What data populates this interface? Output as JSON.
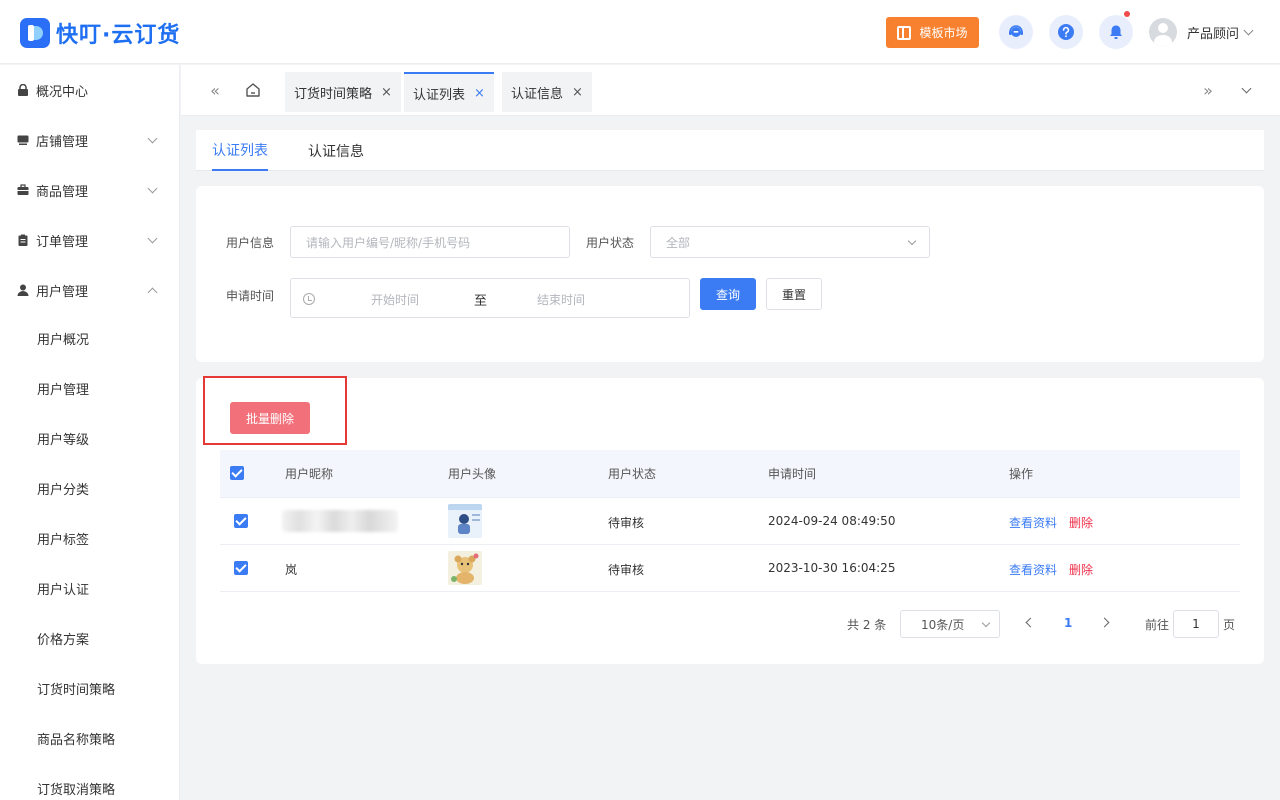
{
  "app": {
    "logo_text": "快叮·云订货"
  },
  "header": {
    "template_market_label": "模板市场",
    "user_name": "产品顾问",
    "icons": [
      "service-icon",
      "help-icon",
      "bell-icon"
    ]
  },
  "sidebar": {
    "groups": [
      {
        "label": "概况中心"
      },
      {
        "label": "店铺管理"
      },
      {
        "label": "商品管理"
      },
      {
        "label": "订单管理"
      },
      {
        "label": "用户管理"
      }
    ],
    "sub_items": [
      "用户概况",
      "用户管理",
      "用户等级",
      "用户分类",
      "用户标签",
      "用户认证",
      "价格方案",
      "订货时间策略",
      "商品名称策略",
      "订货取消策略"
    ]
  },
  "tabs": [
    {
      "label": "订货时间策略",
      "close": "×"
    },
    {
      "label": "认证列表",
      "close": "×"
    },
    {
      "label": "认证信息",
      "close": "×"
    }
  ],
  "subtabs": [
    {
      "label": "认证列表"
    },
    {
      "label": "认证信息"
    }
  ],
  "filter": {
    "user_info_label": "用户信息",
    "user_info_placeholder": "请输入用户编号/昵称/手机号码",
    "user_status_label": "用户状态",
    "user_status_value": "全部",
    "apply_time_label": "申请时间",
    "start_placeholder": "开始时间",
    "range_sep": "至",
    "end_placeholder": "结束时间",
    "query_label": "查询",
    "reset_label": "重置"
  },
  "batch_delete_label": "批量删除",
  "table": {
    "columns": [
      "用户昵称",
      "用户头像",
      "用户状态",
      "申请时间",
      "操作"
    ],
    "rows": [
      {
        "nickname": "",
        "status": "待审核",
        "apply_time": "2024-09-24 08:49:50",
        "view": "查看资料",
        "delete": "删除",
        "checked": true
      },
      {
        "nickname": "岚",
        "status": "待审核",
        "apply_time": "2023-10-30 16:04:25",
        "view": "查看资料",
        "delete": "删除",
        "checked": true
      }
    ]
  },
  "pagination": {
    "total_text": "共 2 条",
    "page_size": "10条/页",
    "current_page": "1",
    "goto_label": "前往",
    "goto_value": "1",
    "page_suffix": "页"
  },
  "colors": {
    "primary": "#3b7cf5",
    "danger": "#f2707a",
    "orange": "#f7812e",
    "highlight": "#e53935"
  }
}
